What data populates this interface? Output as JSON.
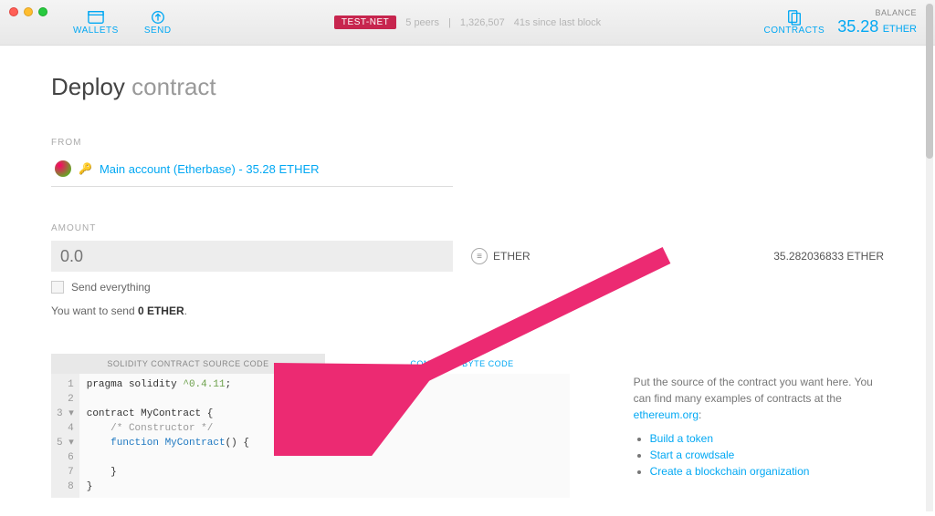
{
  "nav": {
    "wallets": "WALLETS",
    "send": "SEND",
    "contracts": "CONTRACTS"
  },
  "status": {
    "testnet": "TEST-NET",
    "peers": "5 peers",
    "block": "1,326,507",
    "since": "41s since last block"
  },
  "balance": {
    "label": "BALANCE",
    "value": "35.28",
    "unit": "ETHER"
  },
  "page_title": {
    "bold": "Deploy",
    "thin": "contract"
  },
  "from": {
    "label": "FROM",
    "account": "Main account (Etherbase) - 35.28 ETHER"
  },
  "amount": {
    "label": "AMOUNT",
    "placeholder": "0.0",
    "unit": "ETHER",
    "available": "35.282036833 ETHER",
    "send_everything": "Send everything",
    "summary_prefix": "You want to send ",
    "summary_value": "0 ETHER"
  },
  "tabs": {
    "source": "SOLIDITY CONTRACT SOURCE CODE",
    "bytecode": "CONTRACT BYTE CODE"
  },
  "code": {
    "l1a": "pragma solidity ",
    "l1b": "^0.4.11",
    "l1c": ";",
    "l3": "contract MyContract {",
    "l4": "    /* Constructor */",
    "l5a": "    ",
    "l5b": "function",
    "l5c": " ",
    "l5d": "MyContract",
    "l5e": "() {",
    "l7": "    }",
    "l8": "}"
  },
  "help": {
    "text_a": "Put the source of the contract you want here. You can find many examples of contracts at the ",
    "link": "ethereum.org",
    "text_b": ":",
    "li1": "Build a token",
    "li2": "Start a crowdsale",
    "li3": "Create a blockchain organization"
  }
}
